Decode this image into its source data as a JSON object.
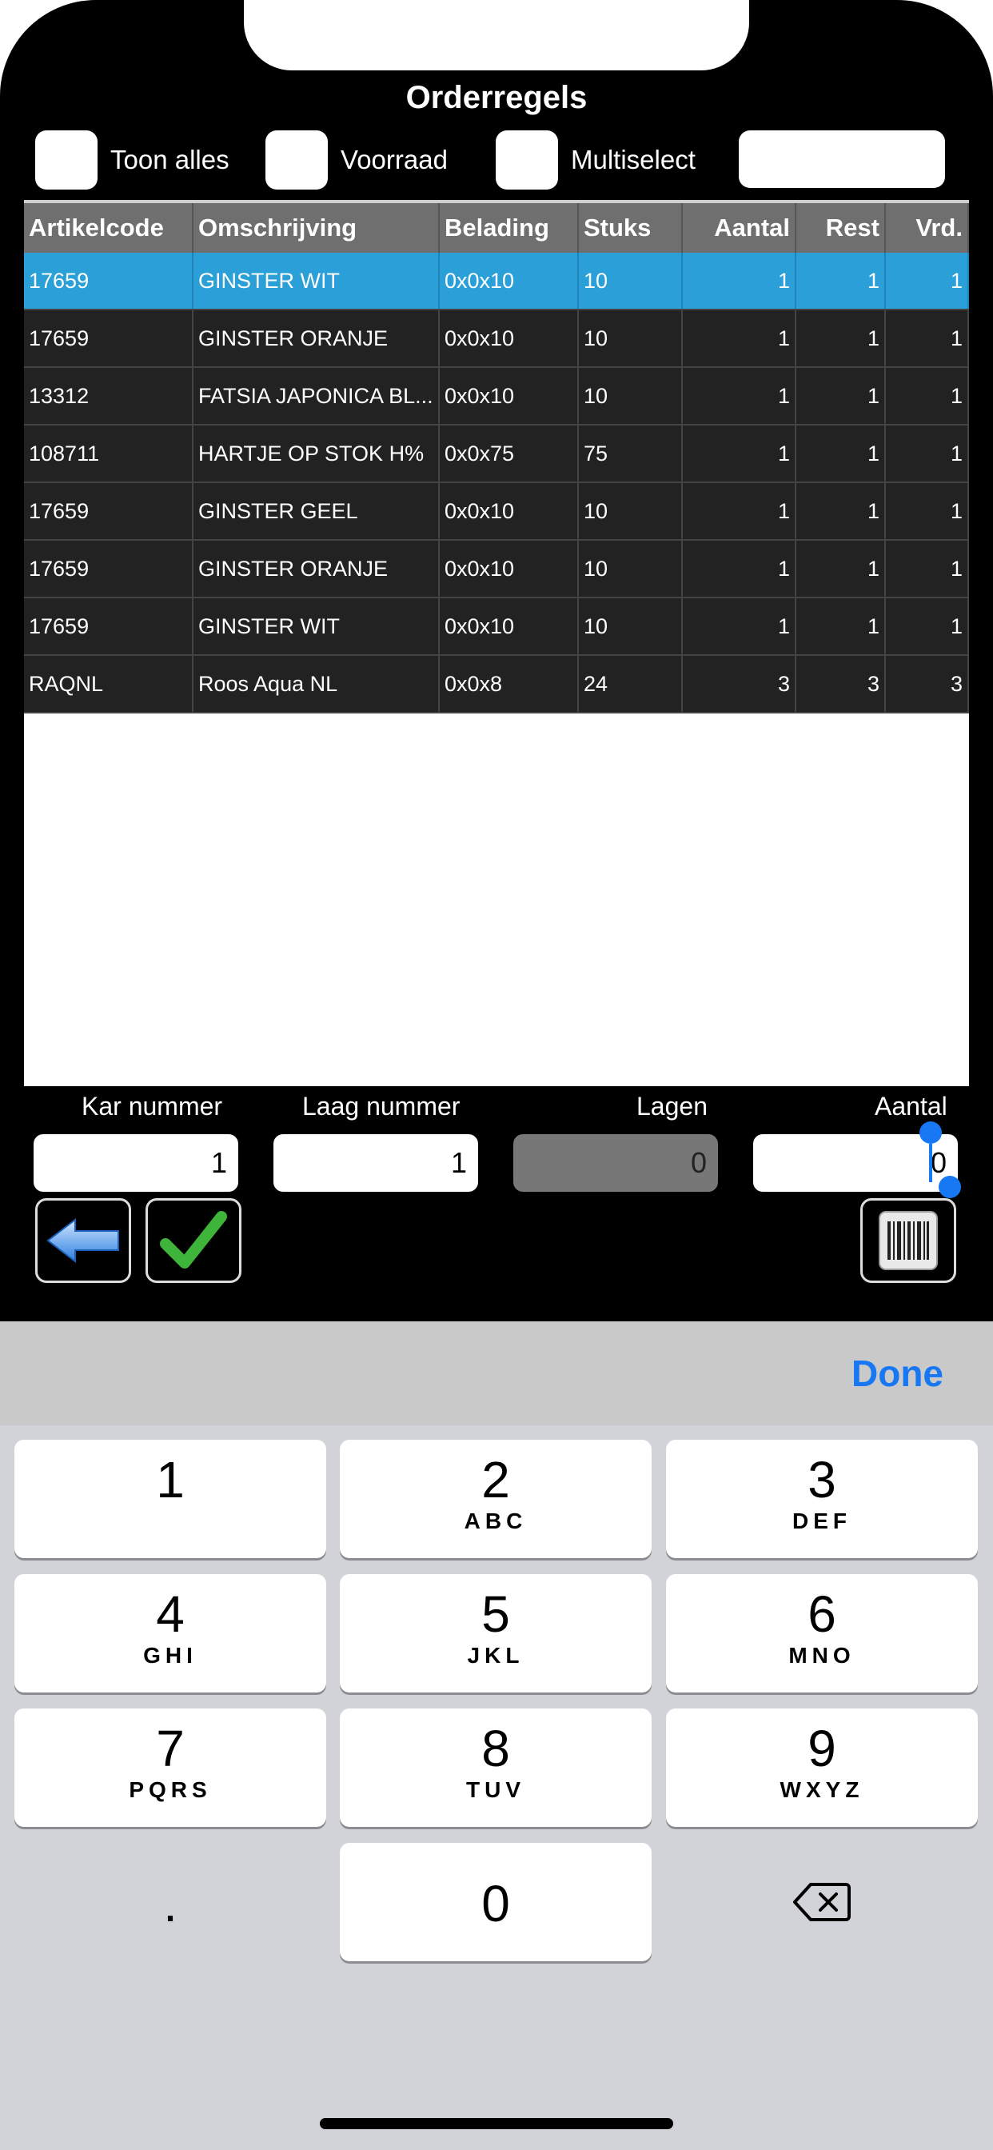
{
  "header": {
    "title": "Orderregels"
  },
  "options": {
    "toon_alles": "Toon alles",
    "voorraad": "Voorraad",
    "multiselect": "Multiselect",
    "filter_value": ""
  },
  "table": {
    "columns": [
      "Artikelcode",
      "Omschrijving",
      "Belading",
      "Stuks",
      "Aantal",
      "Rest",
      "Vrd."
    ],
    "rows": [
      [
        "17659",
        "GINSTER WIT",
        "0x0x10",
        "10",
        "1",
        "1",
        "1"
      ],
      [
        "17659",
        "GINSTER ORANJE",
        "0x0x10",
        "10",
        "1",
        "1",
        "1"
      ],
      [
        "13312",
        "FATSIA JAPONICA BL...",
        "0x0x10",
        "10",
        "1",
        "1",
        "1"
      ],
      [
        "108711",
        "HARTJE OP STOK H%",
        "0x0x75",
        "75",
        "1",
        "1",
        "1"
      ],
      [
        "17659",
        "GINSTER GEEL",
        "0x0x10",
        "10",
        "1",
        "1",
        "1"
      ],
      [
        "17659",
        "GINSTER ORANJE",
        "0x0x10",
        "10",
        "1",
        "1",
        "1"
      ],
      [
        "17659",
        "GINSTER WIT",
        "0x0x10",
        "10",
        "1",
        "1",
        "1"
      ],
      [
        "RAQNL",
        "Roos Aqua NL",
        "0x0x8",
        "24",
        "3",
        "3",
        "3"
      ]
    ],
    "selected_row": 0
  },
  "fields": {
    "kar_label": "Kar nummer",
    "kar_value": "1",
    "laag_label": "Laag nummer",
    "laag_value": "1",
    "lagen_label": "Lagen",
    "lagen_value": "0",
    "aantal_label": "Aantal",
    "aantal_value": "0"
  },
  "keyboard": {
    "done": "Done",
    "keys": [
      {
        "d": "1",
        "l": ""
      },
      {
        "d": "2",
        "l": "ABC"
      },
      {
        "d": "3",
        "l": "DEF"
      },
      {
        "d": "4",
        "l": "GHI"
      },
      {
        "d": "5",
        "l": "JKL"
      },
      {
        "d": "6",
        "l": "MNO"
      },
      {
        "d": "7",
        "l": "PQRS"
      },
      {
        "d": "8",
        "l": "TUV"
      },
      {
        "d": "9",
        "l": "WXYZ"
      },
      {
        "d": ".",
        "l": ""
      },
      {
        "d": "0",
        "l": ""
      },
      {
        "d": "",
        "l": ""
      }
    ]
  },
  "icons": {
    "back": "back-arrow-icon",
    "confirm": "checkmark-icon",
    "barcode": "barcode-icon",
    "delete": "backspace-icon"
  },
  "colors": {
    "selected_row": "#2a9fd8",
    "accent": "#1877f2"
  }
}
